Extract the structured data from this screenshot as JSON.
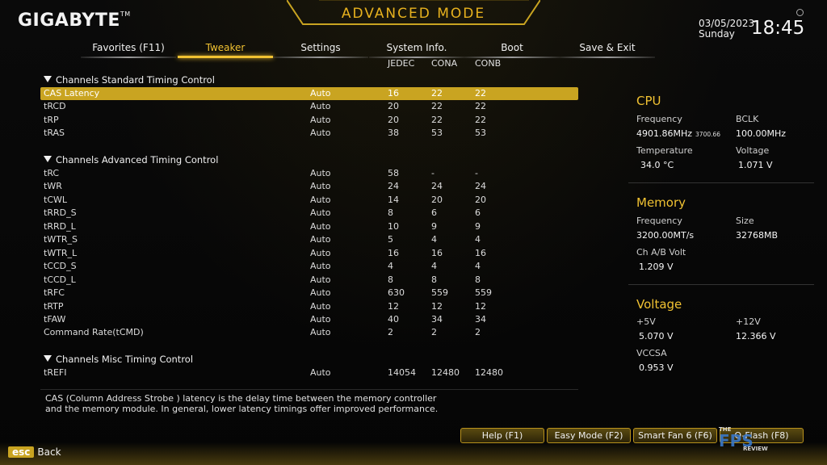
{
  "header": {
    "brand": "GIGABYTE",
    "brand_tm": "TM",
    "mode_title": "ADVANCED MODE",
    "date": "03/05/2023",
    "day": "Sunday",
    "time": "18:45"
  },
  "tabs": [
    {
      "label": "Favorites (F11)",
      "active": false
    },
    {
      "label": "Tweaker",
      "active": true
    },
    {
      "label": "Settings",
      "active": false
    },
    {
      "label": "System Info.",
      "active": false
    },
    {
      "label": "Boot",
      "active": false
    },
    {
      "label": "Save & Exit",
      "active": false
    }
  ],
  "columns": {
    "jedec": "JEDEC",
    "cona": "CONA",
    "conb": "CONB"
  },
  "sections": {
    "standard": "Channels Standard Timing Control",
    "advanced": "Channels Advanced Timing Control",
    "misc": "Channels Misc Timing Control"
  },
  "rows": [
    {
      "name": "CAS Latency",
      "value": "Auto",
      "jedec": "16",
      "cona": "22",
      "conb": "22"
    },
    {
      "name": "tRCD",
      "value": "Auto",
      "jedec": "20",
      "cona": "22",
      "conb": "22"
    },
    {
      "name": "tRP",
      "value": "Auto",
      "jedec": "20",
      "cona": "22",
      "conb": "22"
    },
    {
      "name": "tRAS",
      "value": "Auto",
      "jedec": "38",
      "cona": "53",
      "conb": "53"
    },
    {
      "name": "tRC",
      "value": "Auto",
      "jedec": "58",
      "cona": "-",
      "conb": "-"
    },
    {
      "name": "tWR",
      "value": "Auto",
      "jedec": "24",
      "cona": "24",
      "conb": "24"
    },
    {
      "name": "tCWL",
      "value": "Auto",
      "jedec": "14",
      "cona": "20",
      "conb": "20"
    },
    {
      "name": "tRRD_S",
      "value": "Auto",
      "jedec": "8",
      "cona": "6",
      "conb": "6"
    },
    {
      "name": "tRRD_L",
      "value": "Auto",
      "jedec": "10",
      "cona": "9",
      "conb": "9"
    },
    {
      "name": "tWTR_S",
      "value": "Auto",
      "jedec": "5",
      "cona": "4",
      "conb": "4"
    },
    {
      "name": "tWTR_L",
      "value": "Auto",
      "jedec": "16",
      "cona": "16",
      "conb": "16"
    },
    {
      "name": "tCCD_S",
      "value": "Auto",
      "jedec": "4",
      "cona": "4",
      "conb": "4"
    },
    {
      "name": "tCCD_L",
      "value": "Auto",
      "jedec": "8",
      "cona": "8",
      "conb": "8"
    },
    {
      "name": "tRFC",
      "value": "Auto",
      "jedec": "630",
      "cona": "559",
      "conb": "559"
    },
    {
      "name": "tRTP",
      "value": "Auto",
      "jedec": "12",
      "cona": "12",
      "conb": "12"
    },
    {
      "name": "tFAW",
      "value": "Auto",
      "jedec": "40",
      "cona": "34",
      "conb": "34"
    },
    {
      "name": "Command Rate(tCMD)",
      "value": "Auto",
      "jedec": "2",
      "cona": "2",
      "conb": "2"
    },
    {
      "name": "tREFI",
      "value": "Auto",
      "jedec": "14054",
      "cona": "12480",
      "conb": "12480"
    }
  ],
  "cpu": {
    "title": "CPU",
    "freq_label": "Frequency",
    "freq_value": "4901.86MHz",
    "freq_sub": "3700.66",
    "bclk_label": "BCLK",
    "bclk_value": "100.00MHz",
    "temp_label": "Temperature",
    "temp_value": "34.0 °C",
    "volt_label": "Voltage",
    "volt_value": "1.071 V"
  },
  "memory": {
    "title": "Memory",
    "freq_label": "Frequency",
    "freq_value": "3200.00MT/s",
    "size_label": "Size",
    "size_value": "32768MB",
    "chvolt_label": "Ch A/B Volt",
    "chvolt_value": "1.209 V"
  },
  "voltage": {
    "title": "Voltage",
    "p5_label": "+5V",
    "p5_value": "5.070 V",
    "p12_label": "+12V",
    "p12_value": "12.366 V",
    "vccsa_label": "VCCSA",
    "vccsa_value": "0.953 V"
  },
  "help": {
    "line1": "CAS (Column Address Strobe ) latency is the delay time between the memory controller",
    "line2": "and the memory module. In general, lower latency timings offer improved performance."
  },
  "footer": {
    "help": "Help (F1)",
    "easy": "Easy Mode (F2)",
    "fan": "Smart Fan 6 (F6)",
    "flash": "Q-Flash (F8)",
    "esc_key": "esc",
    "esc_label": "Back"
  },
  "watermark": {
    "the": "THE",
    "fps": "FPS",
    "review": "REVIEW"
  },
  "colors": {
    "accent": "#f1c232",
    "selected_row": "#c9a421"
  }
}
